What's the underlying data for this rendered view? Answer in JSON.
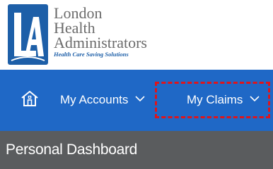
{
  "logo": {
    "mark_letters": "LA",
    "name_lines": [
      "London",
      "Health",
      "Administrators"
    ],
    "tagline": "Health Care Saving Solutions"
  },
  "nav": {
    "home_icon": "home-icon",
    "my_accounts_label": "My Accounts",
    "my_claims_label": "My Claims",
    "chevron_icon": "chevron-down-icon"
  },
  "dashboard": {
    "title": "Personal Dashboard"
  },
  "colors": {
    "nav_bg": "#1f68c6",
    "dashboard_bg": "#5a5c5e",
    "highlight": "#e0141a",
    "logo_blue": "#1d5fa8",
    "logo_gray": "#6b6b6b"
  }
}
